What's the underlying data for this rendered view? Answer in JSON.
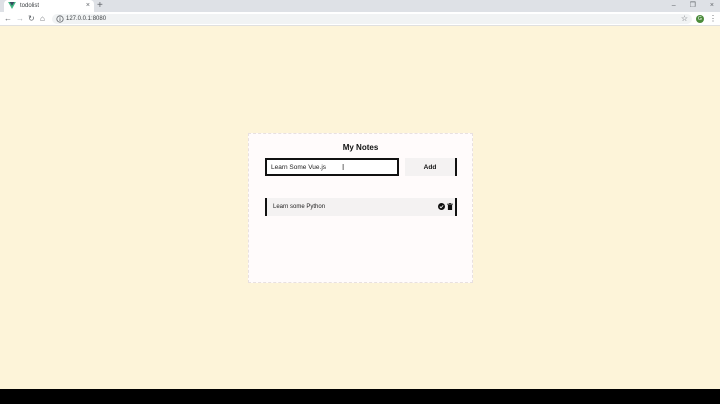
{
  "browser": {
    "tab_title": "todolist",
    "tab_close": "×",
    "new_tab": "+",
    "url": "127.0.0.1:8080",
    "avatar_letter": "G",
    "nav": {
      "back": "←",
      "forward": "→",
      "reload": "↻",
      "home": "⌂"
    },
    "win_controls": {
      "minimize": "–",
      "maximize": "❐",
      "close": "×"
    },
    "star": "☆",
    "menu": "⋮"
  },
  "app": {
    "title": "My Notes",
    "input_value": "Learn Some Vue.js",
    "add_label": "Add",
    "notes": [
      {
        "text": "Learn some Python"
      }
    ]
  },
  "colors": {
    "page_bg": "#fdf4d9",
    "card_bg": "#fffbfb",
    "accent": "#111111"
  }
}
